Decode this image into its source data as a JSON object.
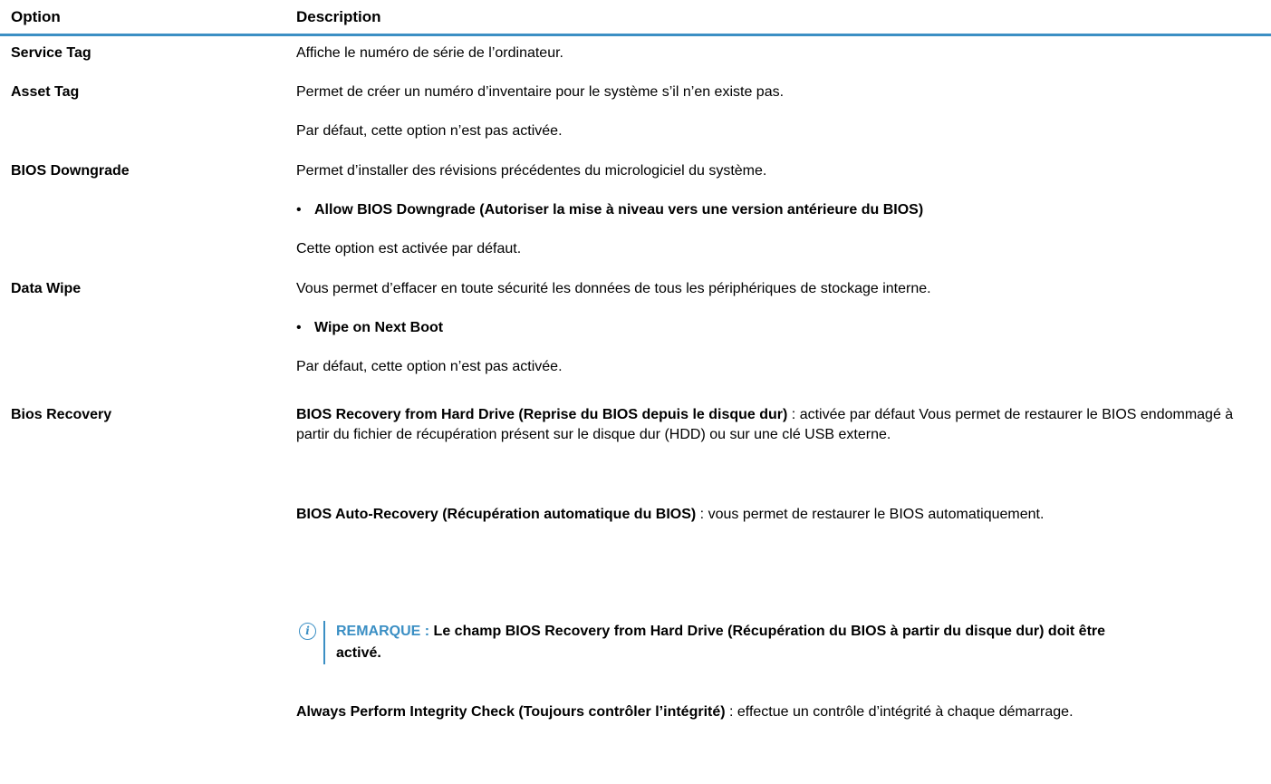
{
  "header": {
    "option": "Option",
    "description": "Description"
  },
  "rows": {
    "service_tag": {
      "label": "Service Tag",
      "desc": "Affiche le numéro de série de l’ordinateur."
    },
    "asset_tag": {
      "label": "Asset Tag",
      "desc": "Permet de créer un numéro d’inventaire pour le système s’il n’en existe pas.",
      "default": "Par défaut, cette option n’est pas activée."
    },
    "bios_downgrade": {
      "label": "BIOS Downgrade",
      "desc": "Permet d’installer des révisions précédentes du micrologiciel du système.",
      "bullet": "Allow BIOS Downgrade (Autoriser la mise à niveau vers une version antérieure du BIOS)",
      "default": "Cette option est activée par défaut."
    },
    "data_wipe": {
      "label": "Data Wipe",
      "desc": "Vous permet d’effacer en toute sécurité les données de tous les périphériques de stockage interne.",
      "bullet": "Wipe on Next Boot",
      "default": "Par défaut, cette option n’est pas activée."
    },
    "bios_recovery": {
      "label": "Bios Recovery",
      "p1_bold": "BIOS Recovery from Hard Drive (Reprise du BIOS depuis le disque dur)",
      "p1_rest": " : activée par défaut Vous permet de restaurer le BIOS endommagé à partir du fichier de récupération présent sur le disque dur (HDD) ou sur une clé USB externe.",
      "p2_bold": "BIOS Auto-Recovery (Récupération automatique du BIOS)",
      "p2_rest": " : vous permet de restaurer le BIOS automatiquement.",
      "note_label": "REMARQUE :",
      "note_text": " Le champ BIOS Recovery from Hard Drive (Récupération du BIOS à partir du disque dur) doit être activé.",
      "p3_bold": "Always Perform Integrity Check (Toujours contrôler l’intégrité)",
      "p3_rest": " : effectue un contrôle d’intégrité à chaque démarrage."
    }
  },
  "bullet_symbol": "•",
  "icons": {
    "note": "info-icon"
  },
  "colors": {
    "accent": "#3b8fc4"
  }
}
